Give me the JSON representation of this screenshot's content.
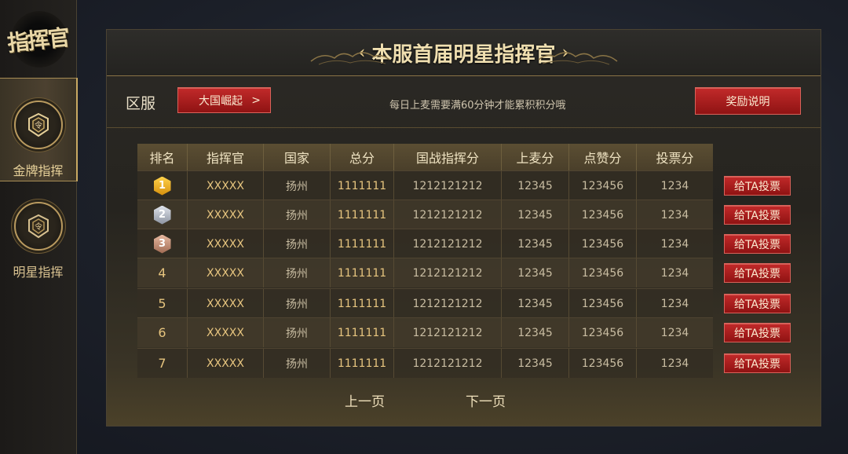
{
  "sidebar": {
    "logo_text": "指挥官",
    "items": [
      {
        "label": "金牌指挥",
        "icon": "command-badge-icon",
        "active": true
      },
      {
        "label": "明星指挥",
        "icon": "command-badge-icon",
        "active": false
      }
    ]
  },
  "panel": {
    "title": "本服首届明星指挥官",
    "title_left": "‹",
    "title_right": "›"
  },
  "filter": {
    "region_label": "区服",
    "region_value": "大国崛起",
    "region_arrow": ">",
    "notice": "每日上麦需要满60分钟才能累积积分哦",
    "reward_button": "奖励说明"
  },
  "table": {
    "headers": [
      "排名",
      "指挥官",
      "国家",
      "总分",
      "国战指挥分",
      "上麦分",
      "点赞分",
      "投票分"
    ],
    "vote_label": "给TA投票",
    "rows": [
      {
        "rank": "1",
        "name": "XXXXX",
        "country": "扬州",
        "total": "1111111",
        "war": "1212121212",
        "mic": "12345",
        "like": "123456",
        "vote": "1234"
      },
      {
        "rank": "2",
        "name": "XXXXX",
        "country": "扬州",
        "total": "1111111",
        "war": "1212121212",
        "mic": "12345",
        "like": "123456",
        "vote": "1234"
      },
      {
        "rank": "3",
        "name": "XXXXX",
        "country": "扬州",
        "total": "1111111",
        "war": "1212121212",
        "mic": "12345",
        "like": "123456",
        "vote": "1234"
      },
      {
        "rank": "4",
        "name": "XXXXX",
        "country": "扬州",
        "total": "1111111",
        "war": "1212121212",
        "mic": "12345",
        "like": "123456",
        "vote": "1234"
      },
      {
        "rank": "5",
        "name": "XXXXX",
        "country": "扬州",
        "total": "1111111",
        "war": "1212121212",
        "mic": "12345",
        "like": "123456",
        "vote": "1234"
      },
      {
        "rank": "6",
        "name": "XXXXX",
        "country": "扬州",
        "total": "1111111",
        "war": "1212121212",
        "mic": "12345",
        "like": "123456",
        "vote": "1234"
      },
      {
        "rank": "7",
        "name": "XXXXX",
        "country": "扬州",
        "total": "1111111",
        "war": "1212121212",
        "mic": "12345",
        "like": "123456",
        "vote": "1234"
      }
    ]
  },
  "pager": {
    "prev": "上一页",
    "next": "下一页"
  },
  "colors": {
    "accent_gold": "#e7c57f",
    "button_red": "#b01f1f"
  }
}
